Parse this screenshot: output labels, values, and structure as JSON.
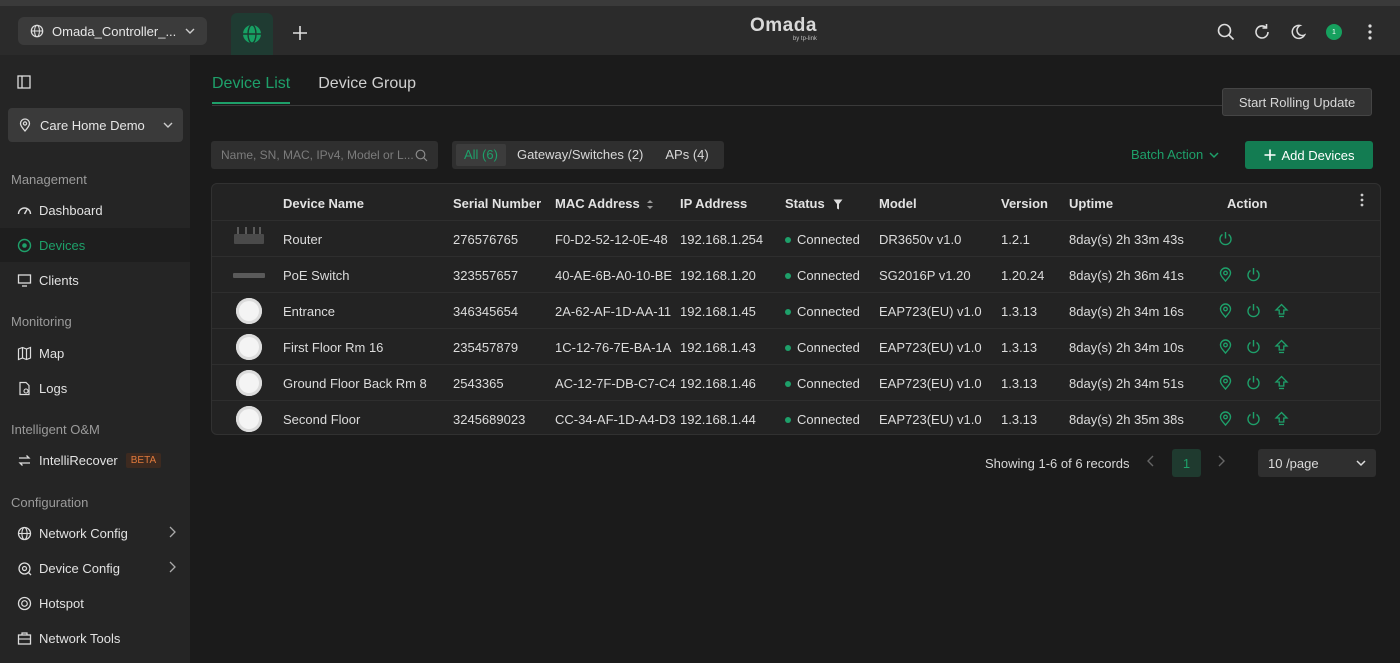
{
  "header": {
    "site_selector": "Omada_Controller_...",
    "logo_text": "Omada",
    "logo_sub": "by tp-link",
    "notification_count": "1",
    "colors": {
      "accent": "#1ea06a",
      "topbar": "#2b2b2b"
    }
  },
  "sidebar": {
    "site": "Care Home Demo",
    "sections": {
      "management": "Management",
      "monitoring": "Monitoring",
      "intelligent": "Intelligent O&M",
      "configuration": "Configuration"
    },
    "items": {
      "dashboard": "Dashboard",
      "devices": "Devices",
      "clients": "Clients",
      "map": "Map",
      "logs": "Logs",
      "intellirecover": "IntelliRecover",
      "beta": "BETA",
      "network_config": "Network Config",
      "device_config": "Device Config",
      "hotspot": "Hotspot",
      "network_tools": "Network Tools"
    }
  },
  "main": {
    "tabs": [
      "Device List",
      "Device Group"
    ],
    "rolling_update": "Start Rolling Update",
    "search_placeholder": "Name, SN, MAC, IPv4, Model or L...",
    "filters": [
      "All (6)",
      "Gateway/Switches (2)",
      "APs (4)"
    ],
    "batch_action": "Batch Action",
    "add_devices": "Add Devices",
    "table": {
      "headers": [
        "Device Name",
        "Serial Number",
        "MAC Address",
        "IP Address",
        "Status",
        "Model",
        "Version",
        "Uptime",
        "Action"
      ],
      "rows": [
        {
          "kind": "router",
          "name": "Router",
          "serial": "276576765",
          "mac": "F0-D2-52-12-0E-48",
          "ip": "192.168.1.254",
          "status": "Connected",
          "model": "DR3650v v1.0",
          "version": "1.2.1",
          "uptime": "8day(s) 2h 33m 43s"
        },
        {
          "kind": "switch",
          "name": "PoE Switch",
          "serial": "323557657",
          "mac": "40-AE-6B-A0-10-BE",
          "ip": "192.168.1.20",
          "status": "Connected",
          "model": "SG2016P v1.20",
          "version": "1.20.24",
          "uptime": "8day(s) 2h 36m 41s"
        },
        {
          "kind": "ap",
          "name": "Entrance",
          "serial": "346345654",
          "mac": "2A-62-AF-1D-AA-11",
          "ip": "192.168.1.45",
          "status": "Connected",
          "model": "EAP723(EU) v1.0",
          "version": "1.3.13",
          "uptime": "8day(s) 2h 34m 16s"
        },
        {
          "kind": "ap",
          "name": "First Floor Rm 16",
          "serial": "235457879",
          "mac": "1C-12-76-7E-BA-1A",
          "ip": "192.168.1.43",
          "status": "Connected",
          "model": "EAP723(EU) v1.0",
          "version": "1.3.13",
          "uptime": "8day(s) 2h 34m 10s"
        },
        {
          "kind": "ap",
          "name": "Ground Floor Back Rm 8",
          "serial": "2543365",
          "mac": "AC-12-7F-DB-C7-C4",
          "ip": "192.168.1.46",
          "status": "Connected",
          "model": "EAP723(EU) v1.0",
          "version": "1.3.13",
          "uptime": "8day(s) 2h 34m 51s"
        },
        {
          "kind": "ap",
          "name": "Second Floor",
          "serial": "3245689023",
          "mac": "CC-34-AF-1D-A4-D3",
          "ip": "192.168.1.44",
          "status": "Connected",
          "model": "EAP723(EU) v1.0",
          "version": "1.3.13",
          "uptime": "8day(s) 2h 35m 38s"
        }
      ]
    },
    "pagination": {
      "summary": "Showing 1-6 of 6 records",
      "current_page": "1",
      "per_page": "10 /page"
    }
  }
}
